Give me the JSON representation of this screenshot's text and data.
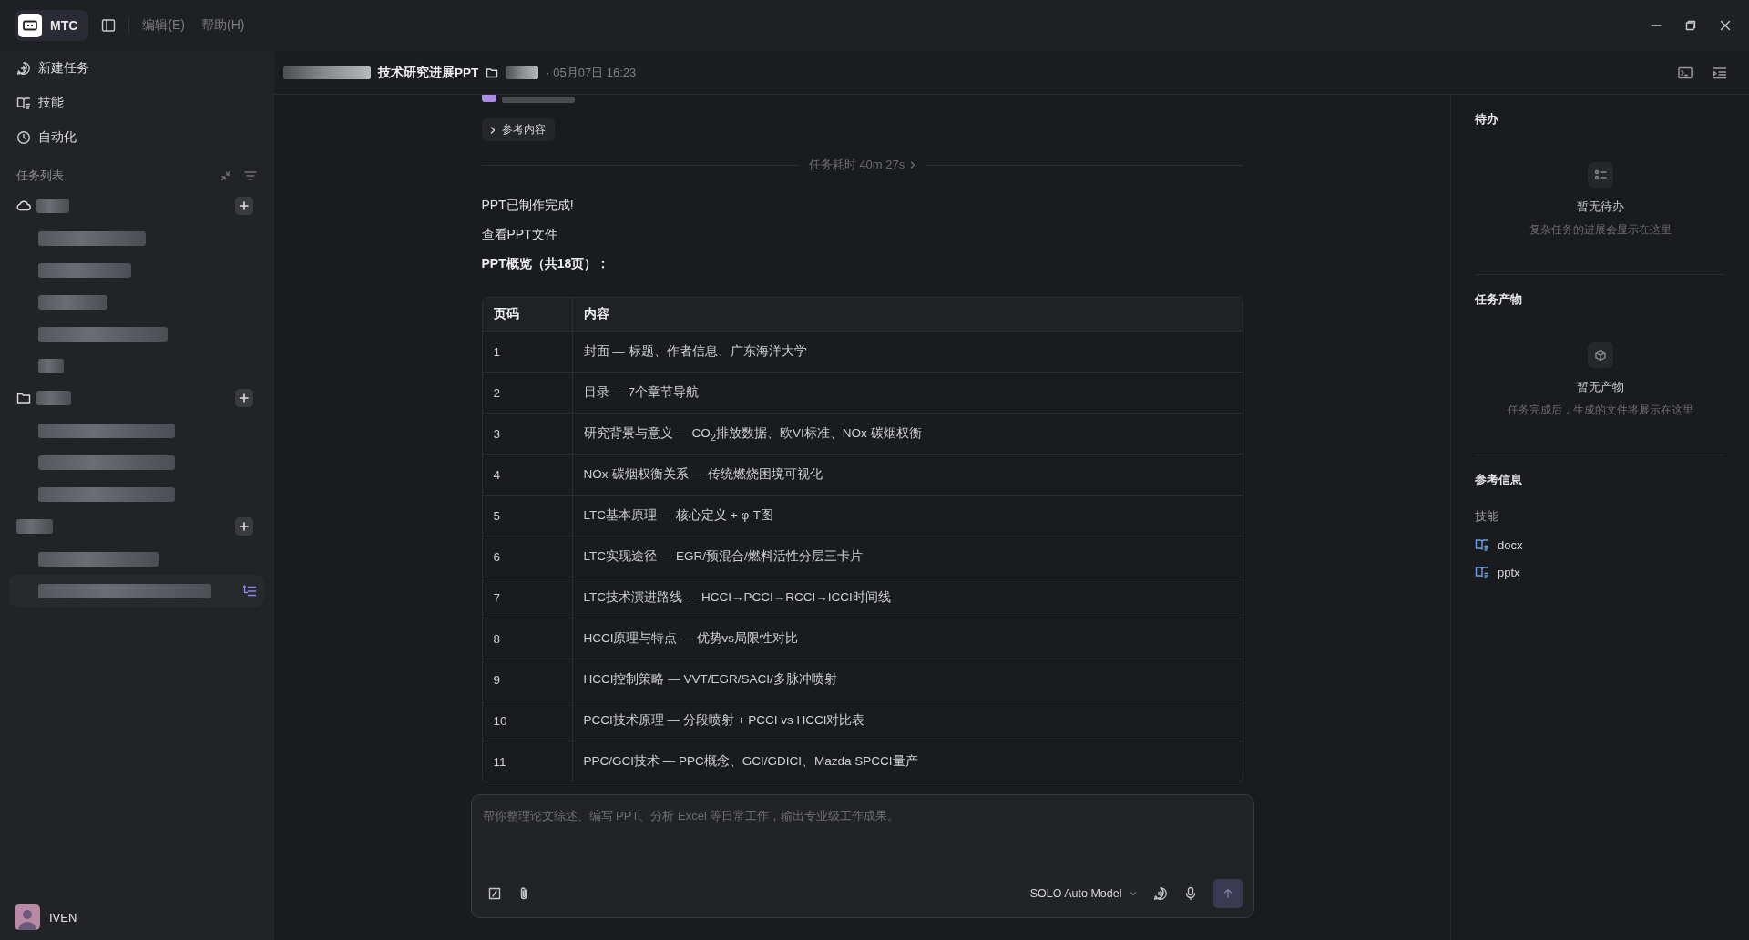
{
  "app": {
    "name": "MTC"
  },
  "menu": [
    {
      "label": "编辑(E)"
    },
    {
      "label": "帮助(H)"
    }
  ],
  "sidebar": {
    "nav": [
      {
        "label": "新建任务",
        "kind": "new"
      },
      {
        "label": "技能",
        "kind": "skills"
      },
      {
        "label": "自动化",
        "kind": "automation"
      }
    ],
    "task_list_title": "任务列表",
    "groups": [
      {
        "kind": "cloud",
        "items": [
          {
            "selected": false
          },
          {
            "selected": false
          },
          {
            "selected": false
          },
          {
            "selected": false
          },
          {
            "selected": false
          }
        ]
      },
      {
        "kind": "folder",
        "items": [
          {
            "selected": false
          },
          {
            "selected": false
          },
          {
            "selected": false
          }
        ]
      },
      {
        "kind": "plain",
        "items": [
          {
            "selected": false
          },
          {
            "selected": true
          }
        ]
      }
    ],
    "user": {
      "name": "IVEN"
    }
  },
  "task": {
    "title": "技术研究进展PPT",
    "time": "· 05月07日 16:23"
  },
  "conversation": {
    "reference_button": "参考内容",
    "duration": "任务耗时 40m 27s",
    "message": "PPT已制作完成!",
    "link": "查看PPT文件",
    "overview": "PPT概览（共18页）：",
    "table": {
      "columns": [
        "页码",
        "内容"
      ],
      "rows": [
        [
          "1",
          "封面 — 标题、作者信息、广东海洋大学"
        ],
        [
          "2",
          "目录 — 7个章节导航"
        ],
        [
          "3",
          "研究背景与意义 — CO$_{2}$排放数据、欧VI标准、NOx-碳烟权衡"
        ],
        [
          "4",
          "NOx-碳烟权衡关系 — 传统燃烧困境可视化"
        ],
        [
          "5",
          "LTC基本原理 — 核心定义 + φ-T图"
        ],
        [
          "6",
          "LTC实现途径 — EGR/预混合/燃料活性分层三卡片"
        ],
        [
          "7",
          "LTC技术演进路线 — HCCI→PCCI→RCCI→ICCI时间线"
        ],
        [
          "8",
          "HCCI原理与特点 — 优势vs局限性对比"
        ],
        [
          "9",
          "HCCI控制策略 — VVT/EGR/SACI/多脉冲喷射"
        ],
        [
          "10",
          "PCCI技术原理 — 分段喷射 + PCCI vs HCCI对比表"
        ],
        [
          "11",
          "PPC/GCI技术 — PPC概念、GCI/GDICI、Mazda SPCCI量产"
        ]
      ]
    }
  },
  "composer": {
    "placeholder": "帮你整理论文综述、编写 PPT、分析 Excel 等日常工作，输出专业级工作成果。",
    "model": "SOLO Auto Model"
  },
  "right_panel": {
    "todo": {
      "title": "待办",
      "empty_title": "暂无待办",
      "empty_hint": "复杂任务的进展会显示在这里"
    },
    "outputs": {
      "title": "任务产物",
      "empty_title": "暂无产物",
      "empty_hint": "任务完成后，生成的文件将展示在这里"
    },
    "reference": {
      "title": "参考信息",
      "skills_label": "技能",
      "skills": [
        "docx",
        "pptx"
      ]
    }
  }
}
